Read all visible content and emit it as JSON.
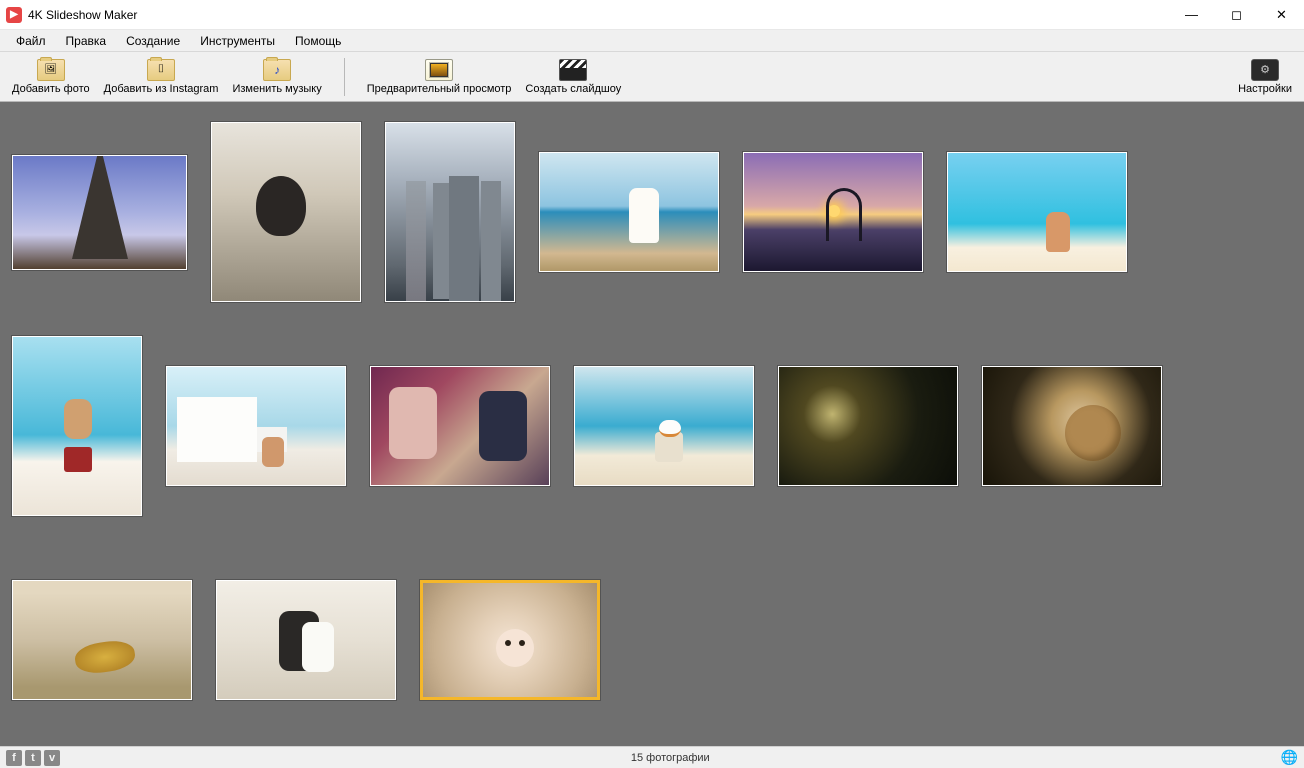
{
  "window": {
    "title": "4K Slideshow Maker"
  },
  "menu": {
    "file": "Файл",
    "edit": "Правка",
    "create": "Создание",
    "tools": "Инструменты",
    "help": "Помощь"
  },
  "toolbar": {
    "add_photo": "Добавить фото",
    "add_instagram": "Добавить из Instagram",
    "change_music": "Изменить музыку",
    "preview": "Предварительный просмотр",
    "create_slideshow": "Создать слайдшоу",
    "settings": "Настройки"
  },
  "thumbs": [
    {
      "id": 1,
      "shape": "w175",
      "subject": "Eiffel Tower, Paris",
      "selected": false
    },
    {
      "id": 2,
      "shape": "w150",
      "subject": "Woman seated by window",
      "selected": false
    },
    {
      "id": 3,
      "shape": "portrait",
      "subject": "City skyline with skyscrapers",
      "selected": false
    },
    {
      "id": 4,
      "shape": "landscape",
      "subject": "Woman walking on beach",
      "selected": false
    },
    {
      "id": 5,
      "shape": "landscape",
      "subject": "Person making heart at purple sunset",
      "selected": false
    },
    {
      "id": 6,
      "shape": "landscape",
      "subject": "Woman sitting on tropical beach",
      "selected": false
    },
    {
      "id": 7,
      "shape": "portrait",
      "subject": "Woman kneeling on beach in red bottoms",
      "selected": false
    },
    {
      "id": 8,
      "shape": "landscape",
      "subject": "Lifeguard tower on beach",
      "selected": false
    },
    {
      "id": 9,
      "shape": "landscape",
      "subject": "Family — parents kissing baby",
      "selected": false
    },
    {
      "id": 10,
      "shape": "landscape",
      "subject": "Woman with sun-hat facing turquoise sea",
      "selected": false
    },
    {
      "id": 11,
      "shape": "landscape",
      "subject": "Christmas tree bokeh lights",
      "selected": false
    },
    {
      "id": 12,
      "shape": "landscape",
      "subject": "Merry Christmas wooden ornament",
      "selected": false
    },
    {
      "id": 13,
      "shape": "landscape",
      "subject": "Wedding rings close-up",
      "selected": false
    },
    {
      "id": 14,
      "shape": "landscape",
      "subject": "Wedding couple with bouquet",
      "selected": false
    },
    {
      "id": 15,
      "shape": "landscape",
      "subject": "Baby lying on knit blanket",
      "selected": true
    }
  ],
  "status": {
    "count_text": "15 фотографии"
  }
}
